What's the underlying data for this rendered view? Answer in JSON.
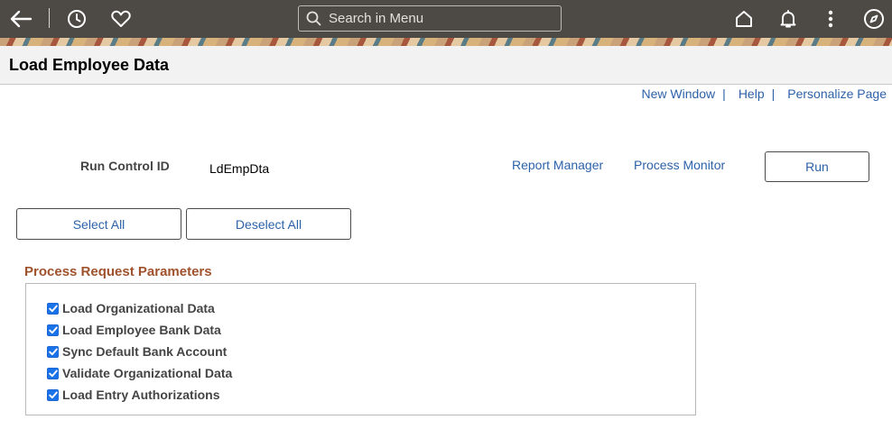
{
  "nav": {
    "search_placeholder": "Search in Menu"
  },
  "page": {
    "title": "Load Employee Data"
  },
  "top_links": {
    "new_window": "New Window",
    "help": "Help",
    "personalize": "Personalize Page",
    "separator": "|"
  },
  "run_control": {
    "label": "Run Control ID",
    "value": "LdEmpDta",
    "report_manager": "Report Manager",
    "process_monitor": "Process Monitor",
    "run_button": "Run"
  },
  "selection": {
    "select_all": "Select All",
    "deselect_all": "Deselect All"
  },
  "parameters": {
    "title": "Process Request Parameters",
    "items": [
      {
        "label": "Load Organizational Data",
        "checked": true
      },
      {
        "label": "Load Employee Bank Data",
        "checked": true
      },
      {
        "label": "Sync Default Bank Account",
        "checked": true
      },
      {
        "label": "Validate Organizational Data",
        "checked": true
      },
      {
        "label": "Load Entry Authorizations",
        "checked": true
      }
    ]
  },
  "colors": {
    "nav_bg": "#4d4a45",
    "link": "#2d62a9",
    "group_title": "#a0522d",
    "checkbox": "#1a73e8"
  }
}
